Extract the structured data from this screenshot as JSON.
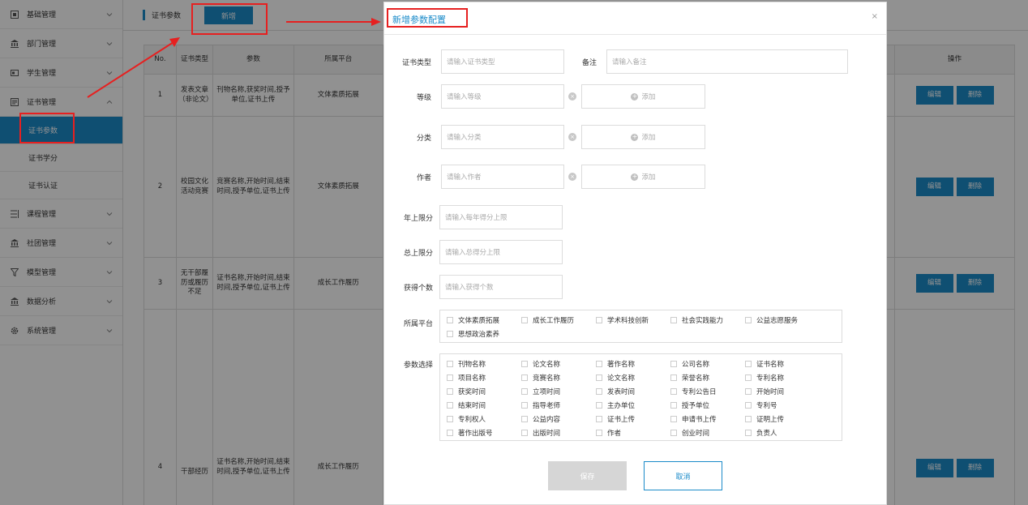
{
  "sidebar": {
    "items": [
      {
        "label": "基础管理",
        "icon": "grid-icon"
      },
      {
        "label": "部门管理",
        "icon": "bank-icon"
      },
      {
        "label": "学生管理",
        "icon": "card-icon"
      },
      {
        "label": "证书管理",
        "icon": "doc-icon"
      }
    ],
    "sub_items": [
      "证书参数",
      "证书学分",
      "证书认证"
    ],
    "items_after": [
      {
        "label": "课程管理",
        "icon": "list-icon"
      },
      {
        "label": "社团管理",
        "icon": "bank-icon"
      },
      {
        "label": "模型管理",
        "icon": "funnel-icon"
      },
      {
        "label": "数据分析",
        "icon": "bank-icon"
      },
      {
        "label": "系统管理",
        "icon": "gear-icon"
      }
    ]
  },
  "topbar": {
    "title": "证书参数",
    "add_label": "新增"
  },
  "table": {
    "headers": [
      "No.",
      "证书类型",
      "参数",
      "所属平台",
      "操作"
    ],
    "rows": [
      {
        "no": "1",
        "type": "发表文章（非论文）",
        "params": "刊物名称,获奖时间,授予单位,证书上传",
        "platform": "文体素质拓展"
      },
      {
        "no": "2",
        "type": "校园文化活动竞赛",
        "params": "竞赛名称,开始时间,结束时间,授予单位,证书上传",
        "platform": "文体素质拓展"
      },
      {
        "no": "3",
        "type": "无干部履历或履历不足",
        "params": "证书名称,开始时间,结束时间,授予单位,证书上传",
        "platform": "成长工作履历"
      },
      {
        "no": "4",
        "type": "干部经历",
        "params": "证书名称,开始时间,结束时间,授予单位,证书上传",
        "platform": "成长工作履历"
      }
    ],
    "edit_label": "编辑",
    "delete_label": "删除"
  },
  "dialog": {
    "title": "新增参数配置",
    "close": "×",
    "fields": {
      "cert_type": {
        "label": "证书类型",
        "placeholder": "请输入证书类型"
      },
      "remark": {
        "label": "备注",
        "placeholder": "请输入备注"
      },
      "level": {
        "label": "等级",
        "placeholder": "请输入等级"
      },
      "category": {
        "label": "分类",
        "placeholder": "请输入分类"
      },
      "author": {
        "label": "作者",
        "placeholder": "请输入作者"
      },
      "year_limit": {
        "label": "年上限分",
        "placeholder": "请输入每年得分上限"
      },
      "total_limit": {
        "label": "总上限分",
        "placeholder": "请输入总得分上限"
      },
      "count": {
        "label": "获得个数",
        "placeholder": "请输入获得个数"
      }
    },
    "add_label": "添加",
    "platform": {
      "label": "所属平台",
      "options": [
        "文体素质拓展",
        "成长工作履历",
        "学术科技创新",
        "社会实践能力",
        "公益志愿服务",
        "思想政治素养"
      ]
    },
    "params": {
      "label": "参数选择",
      "options": [
        "刊物名称",
        "论文名称",
        "著作名称",
        "公司名称",
        "证书名称",
        "项目名称",
        "竞赛名称",
        "论文名称",
        "荣誉名称",
        "专利名称",
        "获奖时间",
        "立项时间",
        "发表时间",
        "专利公告日",
        "开始时间",
        "结束时间",
        "指导老师",
        "主办单位",
        "授予单位",
        "专利号",
        "专利权人",
        "公益内容",
        "证书上传",
        "申请书上传",
        "证明上传",
        "著作出版号",
        "出版时间",
        "作者",
        "创业时间",
        "负责人"
      ]
    },
    "save_label": "保存",
    "cancel_label": "取消"
  }
}
